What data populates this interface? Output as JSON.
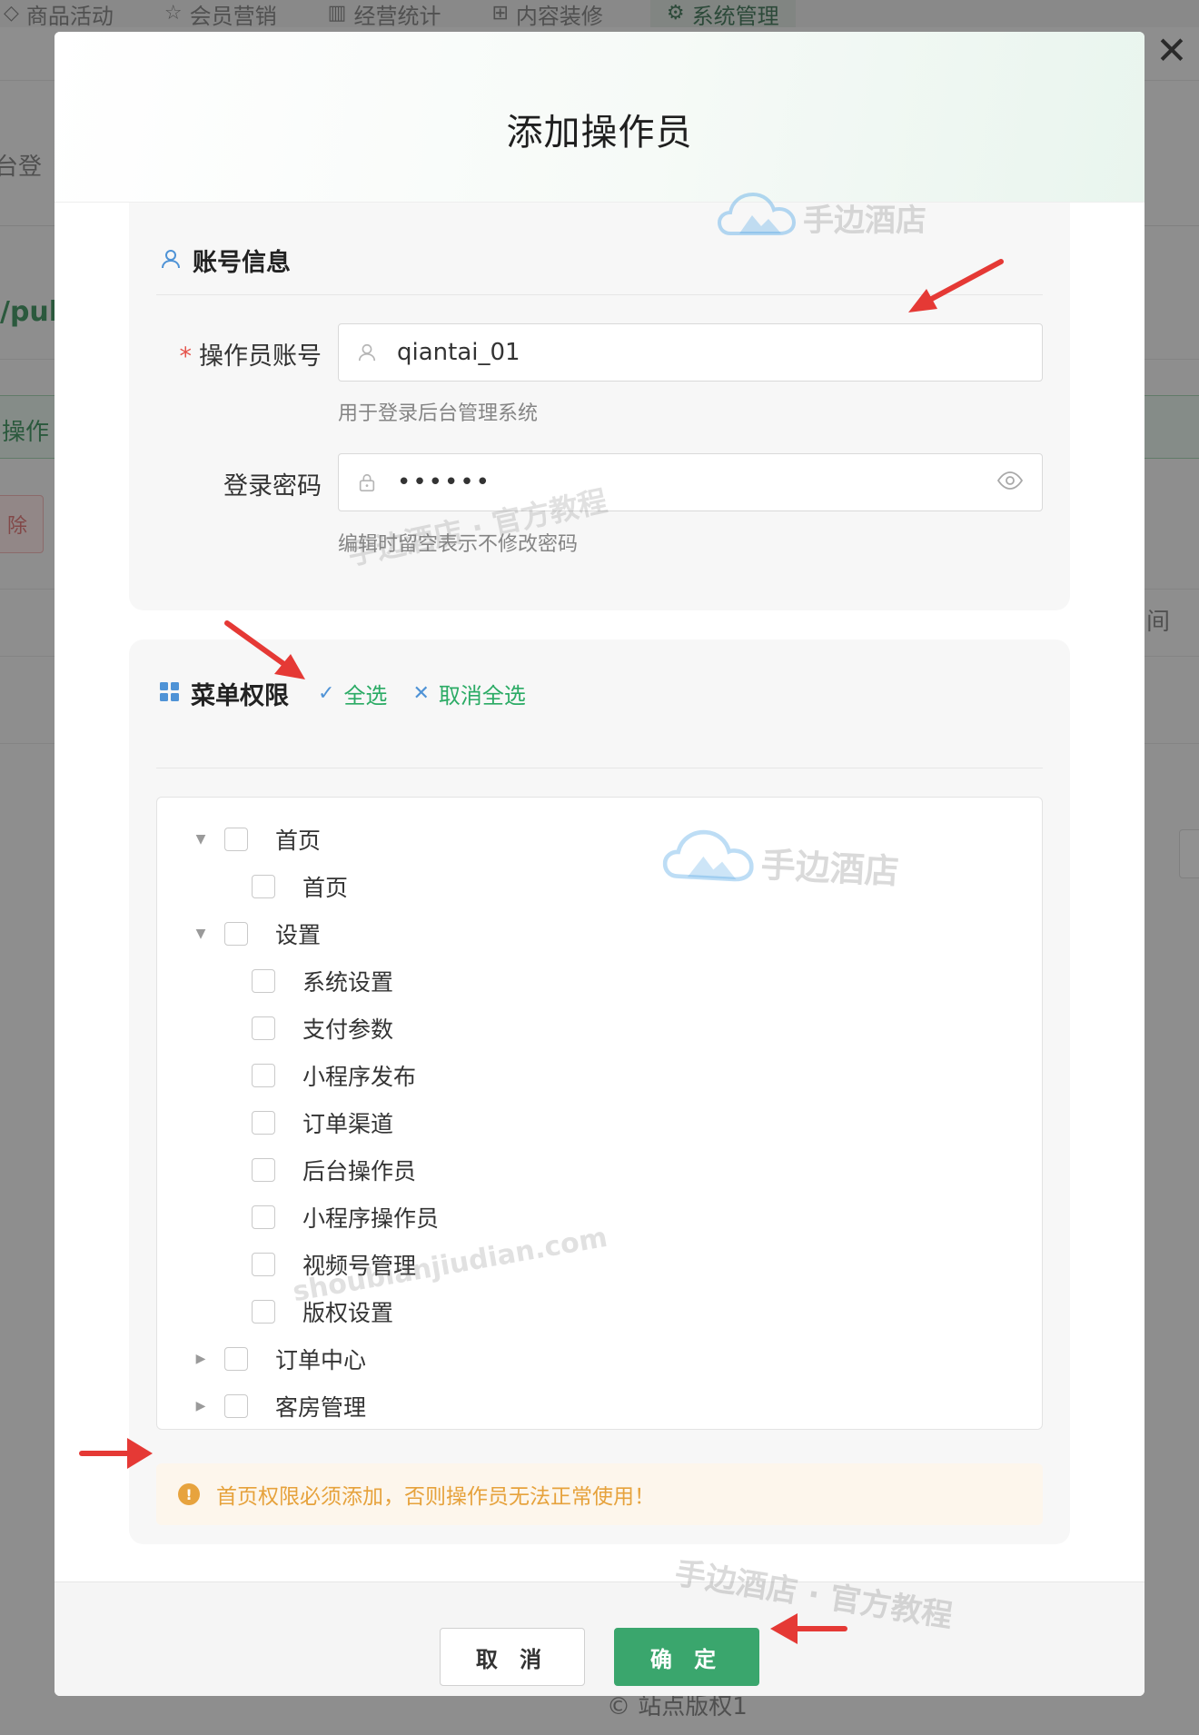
{
  "background": {
    "nav_items": [
      {
        "label": "商品活动",
        "icon": "tag-icon"
      },
      {
        "label": "会员营销",
        "icon": "user-star-icon"
      },
      {
        "label": "经营统计",
        "icon": "chart-icon"
      },
      {
        "label": "内容装修",
        "icon": "layout-icon"
      },
      {
        "label": "系统管理",
        "icon": "gear-icon"
      }
    ],
    "fragment_login": "台登",
    "fragment_path": "/pub",
    "fragment_operator": "操作",
    "fragment_delete": "除",
    "fragment_time": "间",
    "footer_copyright": "站点版权1"
  },
  "modal": {
    "title": "添加操作员",
    "close_icon": "close-icon",
    "account_section": {
      "title": "账号信息",
      "icon": "user-icon",
      "account_label": "操作员账号",
      "account_required_mark": "*",
      "account_value": "qiantai_01",
      "account_hint": "用于登录后台管理系统",
      "password_label": "登录密码",
      "password_value": "••••••",
      "password_hint": "编辑时留空表示不修改密码"
    },
    "menu_section": {
      "title": "菜单权限",
      "icon": "grid-icon",
      "select_all": "全选",
      "deselect_all": "取消全选",
      "tree": [
        {
          "label": "首页",
          "expanded": true,
          "checked": false,
          "children": [
            {
              "label": "首页",
              "checked": false
            }
          ]
        },
        {
          "label": "设置",
          "expanded": true,
          "checked": false,
          "children": [
            {
              "label": "系统设置",
              "checked": false
            },
            {
              "label": "支付参数",
              "checked": false
            },
            {
              "label": "小程序发布",
              "checked": false
            },
            {
              "label": "订单渠道",
              "checked": false
            },
            {
              "label": "后台操作员",
              "checked": false
            },
            {
              "label": "小程序操作员",
              "checked": false
            },
            {
              "label": "视频号管理",
              "checked": false
            },
            {
              "label": "版权设置",
              "checked": false
            }
          ]
        },
        {
          "label": "订单中心",
          "expanded": false,
          "checked": false
        },
        {
          "label": "客房管理",
          "expanded": false,
          "checked": false
        }
      ],
      "warning": "首页权限必须添加，否则操作员无法正常使用！"
    },
    "footer": {
      "cancel_label": "取 消",
      "ok_label": "确 定"
    }
  },
  "watermarks": {
    "brand": "手边酒店",
    "tutorial_1": "手边酒店 · 官方教程",
    "tutorial_2": "手边酒店 · 官方教程",
    "url": "shoubianjiudian.com"
  },
  "colors": {
    "accent_green": "#3aa66d",
    "link_green": "#2bab65",
    "required_red": "#e5534b",
    "warning_orange": "#e6a23c",
    "annotation_red": "#e53935"
  }
}
